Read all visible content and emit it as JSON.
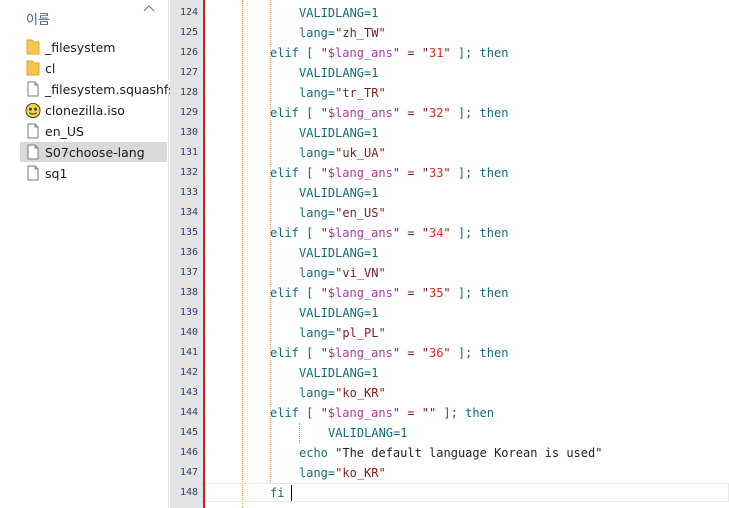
{
  "explorer": {
    "column_header": "이름",
    "files": [
      {
        "name": "_filesystem",
        "icon": "folder-icon",
        "selected": false
      },
      {
        "name": "cl",
        "icon": "folder-icon",
        "selected": false
      },
      {
        "name": "_filesystem.squashfs",
        "icon": "file-icon",
        "selected": false
      },
      {
        "name": "clonezilla.iso",
        "icon": "disc-image-icon",
        "selected": false
      },
      {
        "name": "en_US",
        "icon": "file-icon",
        "selected": false
      },
      {
        "name": "S07choose-lang",
        "icon": "file-icon",
        "selected": true
      },
      {
        "name": "sq1",
        "icon": "file-icon",
        "selected": false
      }
    ]
  },
  "editor": {
    "lines": [
      {
        "n": "124",
        "indent": 2,
        "tokens": [
          {
            "t": "VALIDLANG=1",
            "c": "kw"
          }
        ]
      },
      {
        "n": "125",
        "indent": 2,
        "tokens": [
          {
            "t": "lang=",
            "c": "kw"
          },
          {
            "t": "\"zh_TW\"",
            "c": "str"
          }
        ]
      },
      {
        "n": "126",
        "indent": 1,
        "tokens": [
          {
            "t": "elif [ ",
            "c": "kw"
          },
          {
            "t": "\"",
            "c": "str"
          },
          {
            "t": "$lang_ans",
            "c": "var"
          },
          {
            "t": "\" = \"",
            "c": "str"
          },
          {
            "t": "31",
            "c": "num"
          },
          {
            "t": "\"",
            "c": "str"
          },
          {
            "t": " ]; then",
            "c": "kw"
          }
        ]
      },
      {
        "n": "127",
        "indent": 2,
        "tokens": [
          {
            "t": "VALIDLANG=1",
            "c": "kw"
          }
        ]
      },
      {
        "n": "128",
        "indent": 2,
        "tokens": [
          {
            "t": "lang=",
            "c": "kw"
          },
          {
            "t": "\"tr_TR\"",
            "c": "str"
          }
        ]
      },
      {
        "n": "129",
        "indent": 1,
        "tokens": [
          {
            "t": "elif [ ",
            "c": "kw"
          },
          {
            "t": "\"",
            "c": "str"
          },
          {
            "t": "$lang_ans",
            "c": "var"
          },
          {
            "t": "\" = \"",
            "c": "str"
          },
          {
            "t": "32",
            "c": "num"
          },
          {
            "t": "\"",
            "c": "str"
          },
          {
            "t": " ]; then",
            "c": "kw"
          }
        ]
      },
      {
        "n": "130",
        "indent": 2,
        "tokens": [
          {
            "t": "VALIDLANG=1",
            "c": "kw"
          }
        ]
      },
      {
        "n": "131",
        "indent": 2,
        "tokens": [
          {
            "t": "lang=",
            "c": "kw"
          },
          {
            "t": "\"uk_UA\"",
            "c": "str"
          }
        ]
      },
      {
        "n": "132",
        "indent": 1,
        "tokens": [
          {
            "t": "elif [ ",
            "c": "kw"
          },
          {
            "t": "\"",
            "c": "str"
          },
          {
            "t": "$lang_ans",
            "c": "var"
          },
          {
            "t": "\" = \"",
            "c": "str"
          },
          {
            "t": "33",
            "c": "num"
          },
          {
            "t": "\"",
            "c": "str"
          },
          {
            "t": " ]; then",
            "c": "kw"
          }
        ]
      },
      {
        "n": "133",
        "indent": 2,
        "tokens": [
          {
            "t": "VALIDLANG=1",
            "c": "kw"
          }
        ]
      },
      {
        "n": "134",
        "indent": 2,
        "tokens": [
          {
            "t": "lang=",
            "c": "kw"
          },
          {
            "t": "\"en_US\"",
            "c": "str"
          }
        ]
      },
      {
        "n": "135",
        "indent": 1,
        "tokens": [
          {
            "t": "elif [ ",
            "c": "kw"
          },
          {
            "t": "\"",
            "c": "str"
          },
          {
            "t": "$lang_ans",
            "c": "var"
          },
          {
            "t": "\" = \"",
            "c": "str"
          },
          {
            "t": "34",
            "c": "num"
          },
          {
            "t": "\"",
            "c": "str"
          },
          {
            "t": " ]; then",
            "c": "kw"
          }
        ]
      },
      {
        "n": "136",
        "indent": 2,
        "tokens": [
          {
            "t": "VALIDLANG=1",
            "c": "kw"
          }
        ]
      },
      {
        "n": "137",
        "indent": 2,
        "tokens": [
          {
            "t": "lang=",
            "c": "kw"
          },
          {
            "t": "\"vi_VN\"",
            "c": "str"
          }
        ]
      },
      {
        "n": "138",
        "indent": 1,
        "tokens": [
          {
            "t": "elif [ ",
            "c": "kw"
          },
          {
            "t": "\"",
            "c": "str"
          },
          {
            "t": "$lang_ans",
            "c": "var"
          },
          {
            "t": "\" = \"",
            "c": "str"
          },
          {
            "t": "35",
            "c": "num"
          },
          {
            "t": "\"",
            "c": "str"
          },
          {
            "t": " ]; then",
            "c": "kw"
          }
        ]
      },
      {
        "n": "139",
        "indent": 2,
        "tokens": [
          {
            "t": "VALIDLANG=1",
            "c": "kw"
          }
        ]
      },
      {
        "n": "140",
        "indent": 2,
        "tokens": [
          {
            "t": "lang=",
            "c": "kw"
          },
          {
            "t": "\"pl_PL\"",
            "c": "str"
          }
        ]
      },
      {
        "n": "141",
        "indent": 1,
        "tokens": [
          {
            "t": "elif [ ",
            "c": "kw"
          },
          {
            "t": "\"",
            "c": "str"
          },
          {
            "t": "$lang_ans",
            "c": "var"
          },
          {
            "t": "\" = \"",
            "c": "str"
          },
          {
            "t": "36",
            "c": "num"
          },
          {
            "t": "\"",
            "c": "str"
          },
          {
            "t": " ]; then",
            "c": "kw"
          }
        ]
      },
      {
        "n": "142",
        "indent": 2,
        "tokens": [
          {
            "t": "VALIDLANG=1",
            "c": "kw"
          }
        ]
      },
      {
        "n": "143",
        "indent": 2,
        "tokens": [
          {
            "t": "lang=",
            "c": "kw"
          },
          {
            "t": "\"ko_KR\"",
            "c": "str"
          }
        ]
      },
      {
        "n": "144",
        "indent": 1,
        "tokens": [
          {
            "t": "elif [ ",
            "c": "kw"
          },
          {
            "t": "\"",
            "c": "str"
          },
          {
            "t": "$lang_ans",
            "c": "var"
          },
          {
            "t": "\" = \"\"",
            "c": "str"
          },
          {
            "t": " ]; then",
            "c": "kw"
          }
        ]
      },
      {
        "n": "145",
        "indent": 3,
        "tokens": [
          {
            "t": "VALIDLANG=1",
            "c": "kw"
          }
        ]
      },
      {
        "n": "146",
        "indent": 2,
        "tokens": [
          {
            "t": "echo ",
            "c": "kw"
          },
          {
            "t": "\"The default language Korean is used\"",
            "c": "plain"
          }
        ]
      },
      {
        "n": "147",
        "indent": 2,
        "tokens": [
          {
            "t": "lang=",
            "c": "kw"
          },
          {
            "t": "\"ko_KR\"",
            "c": "str"
          }
        ]
      },
      {
        "n": "148",
        "indent": 1,
        "tokens": [
          {
            "t": "fi",
            "c": "kw"
          }
        ]
      }
    ]
  }
}
